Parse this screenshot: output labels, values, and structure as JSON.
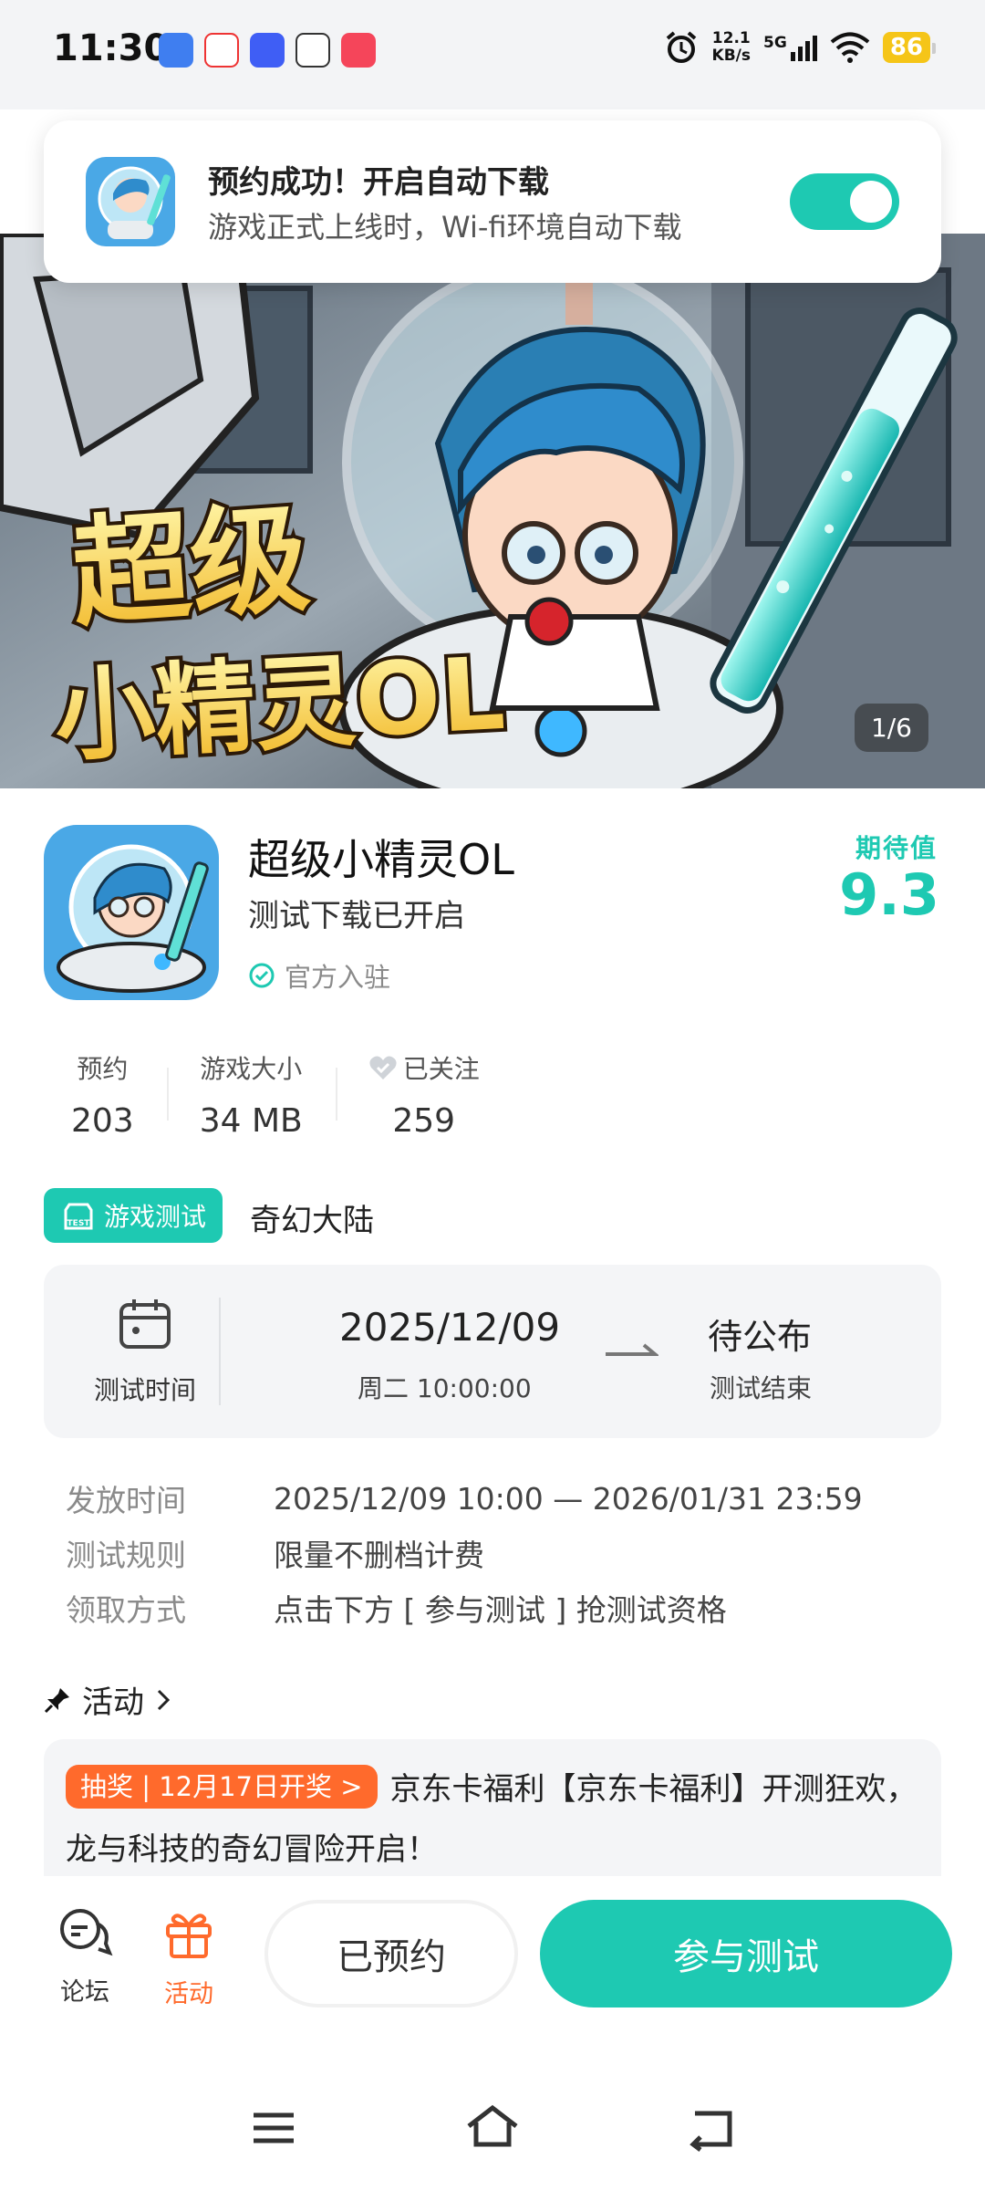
{
  "status_bar": {
    "time": "11:30",
    "net_speed_value": "12.1",
    "net_speed_unit": "KB/s",
    "network_type": "5G",
    "battery": "86"
  },
  "notification": {
    "title": "预约成功！开启自动下载",
    "subtitle": "游戏正式上线时，Wi-fi环境自动下载",
    "toggle_on": true
  },
  "banner": {
    "title_line1": "超级",
    "title_line2": "小精灵OL",
    "counter": "1/6"
  },
  "game": {
    "name": "超级小精灵OL",
    "status": "测试下载已开启",
    "official_label": "官方入驻",
    "rating_label": "期待值",
    "rating_value": "9.3"
  },
  "stats": [
    {
      "label": "预约",
      "value": "203"
    },
    {
      "label": "游戏大小",
      "value": "34 MB"
    },
    {
      "label": "已关注",
      "value": "259"
    }
  ],
  "test": {
    "tag_label": "游戏测试",
    "tag_icon_text": "TEST",
    "region": "奇幻大陆",
    "time_label": "测试时间",
    "start_date": "2025/12/09",
    "start_time": "周二  10:00:00",
    "end_state": "待公布",
    "end_label": "测试结束"
  },
  "details": [
    {
      "key": "发放时间",
      "value": "2025/12/09 10:00 — 2026/01/31 23:59"
    },
    {
      "key": "测试规则",
      "value": "限量不删档计费"
    },
    {
      "key": "领取方式",
      "value": "点击下方 [ 参与测试 ] 抢测试资格"
    }
  ],
  "activity": {
    "heading": "活动",
    "badge": "抽奖 | 12月17日开奖 >",
    "text": "京东卡福利【京东卡福利】开测狂欢，龙与科技的奇幻冒险开启！"
  },
  "bottom": {
    "forum_label": "论坛",
    "activity_label": "活动",
    "reserved_button": "已预约",
    "join_button": "参与测试"
  },
  "colors": {
    "accent": "#1ec9b2",
    "orange": "#ff6a2c",
    "battery": "#f5c518"
  }
}
